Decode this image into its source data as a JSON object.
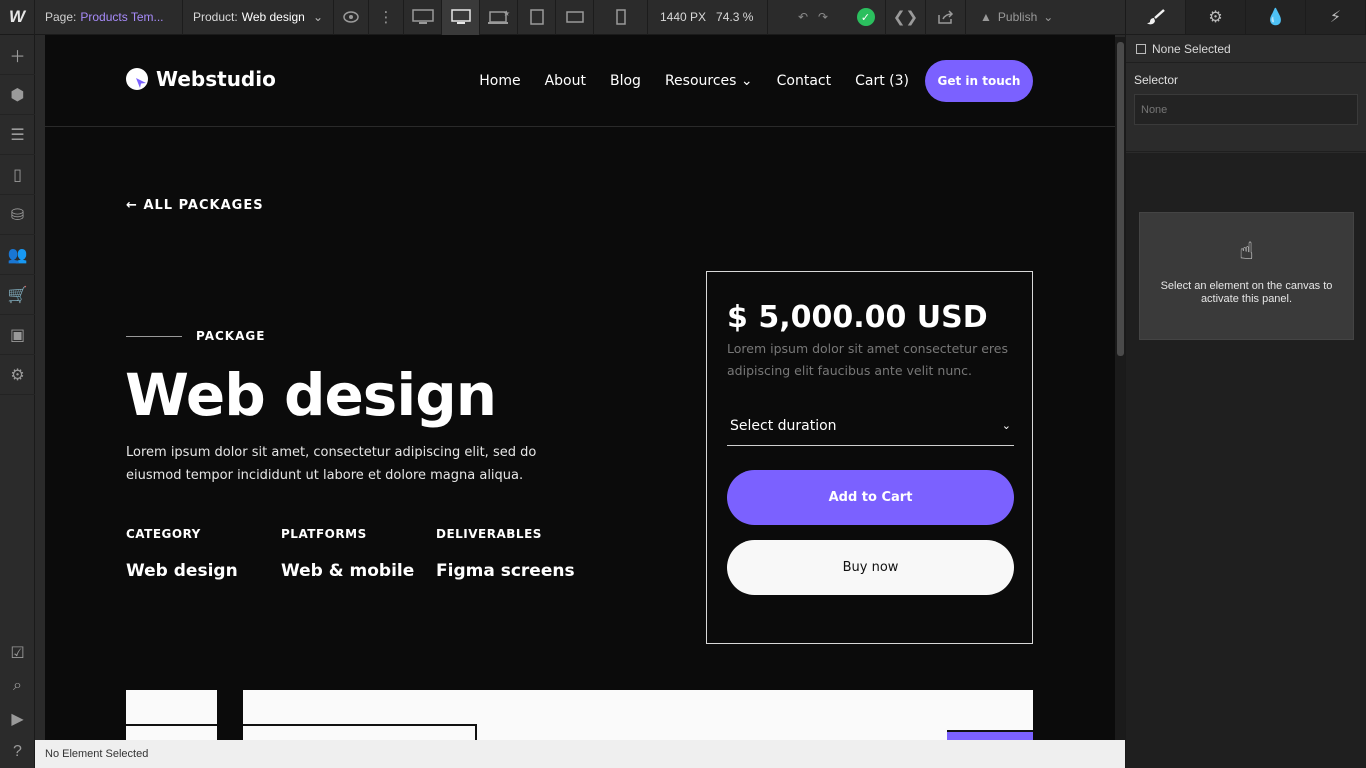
{
  "topbar": {
    "logo": "W",
    "page_label": "Page:",
    "page_value": "Products Tem...",
    "product_label": "Product:",
    "product_value": "Web design",
    "width_readout": "1440 PX",
    "zoom_readout": "74.3 %",
    "publish_label": "Publish",
    "status_color": "#2bbf5e"
  },
  "site": {
    "brand": "Webstudio",
    "nav": [
      "Home",
      "About",
      "Blog",
      "Resources",
      "Contact",
      "Cart (3)"
    ],
    "nav_cta": "Get in touch",
    "accent_color": "#7b61ff",
    "back_link": "ALL PACKAGES",
    "eyebrow": "PACKAGE",
    "title": "Web design",
    "description": "Lorem ipsum dolor sit amet, consectetur adipiscing elit, sed do eiusmod tempor incididunt ut labore et dolore magna aliqua.",
    "specs": [
      {
        "label": "CATEGORY",
        "value": "Web design"
      },
      {
        "label": "PLATFORMS",
        "value": "Web & mobile"
      },
      {
        "label": "DELIVERABLES",
        "value": "Figma screens"
      }
    ],
    "card": {
      "price": "$ 5,000.00 USD",
      "description": "Lorem ipsum dolor sit amet consectetur eres adipiscing elit faucibus ante velit nunc.",
      "duration": "Select duration",
      "add_to_cart": "Add to Cart",
      "buy_now": "Buy now"
    }
  },
  "statusbar": {
    "text": "No Element Selected"
  },
  "panel": {
    "none_selected": "None Selected",
    "selector_label": "Selector",
    "selector_placeholder": "None",
    "hint": "Select an element on the canvas to activate this panel."
  }
}
